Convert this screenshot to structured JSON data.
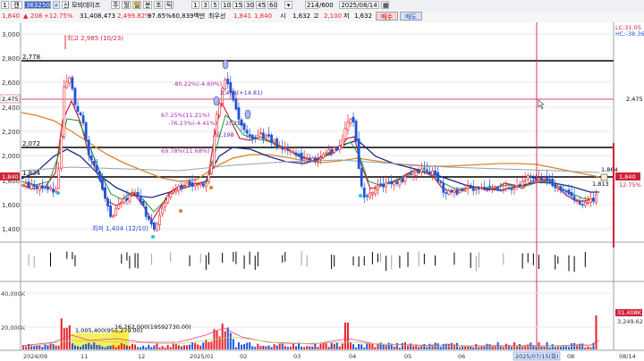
{
  "toolbar": {
    "period_prefix": "1",
    "kind": "캔",
    "code": "363250",
    "name": "모비데이즈",
    "periods": [
      "주",
      "월",
      "분",
      "초",
      "틱"
    ],
    "minutes": [
      "1",
      "3",
      "5",
      "10",
      "15",
      "30",
      "45",
      "60"
    ],
    "count": "214",
    "count_total": "/600",
    "date": "2025/08/14"
  },
  "info": {
    "price": "1,840",
    "change": "▲",
    "change_amt": "208",
    "change_pct": "+12.75%",
    "volume": "31,408,473",
    "vol_ratio": "2,499.82%",
    "other_pct": "97.65%",
    "amount": "60,839백만",
    "pref_label": "최우선",
    "pref_ask": "1,841",
    "pref_bid": "1,840",
    "open_label": "시",
    "open": "1,632",
    "high_label": "고",
    "high": "2,100",
    "low_label": "저",
    "low": "1,632",
    "buy_label": "매수",
    "sell_label": "매도"
  },
  "price_axis": [
    "3,000",
    "2,800",
    "2,600",
    "2,400",
    "2,200",
    "2,000",
    "1,800",
    "1,600",
    "1,400"
  ],
  "right_axis": {
    "lc": "LC:31.05",
    "hc": "HC:-38.36",
    "hline_2475": "2,475",
    "price_tag": "1,840",
    "pct_tag": "12.75%"
  },
  "hlines": {
    "h2778": "2,778",
    "h2475": "2,475",
    "h2072": "2,072",
    "h1834": "1,834"
  },
  "annotations": {
    "max": "최고 2,985 (10/23)",
    "min": "최저 1,404 (12/10)",
    "a1": "-80.22%(-4.60%)",
    "a2": "67.25%(11.21%)",
    "a3": "-76.23%(-4.41%)",
    "a4": "69.78%(11.68%)",
    "a5": "2,459(+14.81)",
    "a6": "1,864",
    "a7": "1,813",
    "a8": "2,198",
    "a9": "2(-25)"
  },
  "volume_axis": [
    "40,000K",
    "20,000K"
  ],
  "volume_tags": {
    "vol_now": "31,408K",
    "vol_ref": "3,249.62"
  },
  "volume_annotations": {
    "v1": "1,005,400(955,279.00)",
    "v2": "16,262,000(19592730.00)"
  },
  "date_axis": [
    "2024/09",
    "11",
    "12",
    "2025/01",
    "02",
    "03",
    "04",
    "05",
    "06",
    "07",
    "08",
    "08/14"
  ],
  "cursor_date": "2025/07/15(화)",
  "colors": {
    "up": "#e8202a",
    "down": "#1e54d8",
    "ma5": "#e13c8f",
    "ma20": "#1b2a8a",
    "ma60": "#d8842a",
    "cursor": "#e0304a"
  }
}
